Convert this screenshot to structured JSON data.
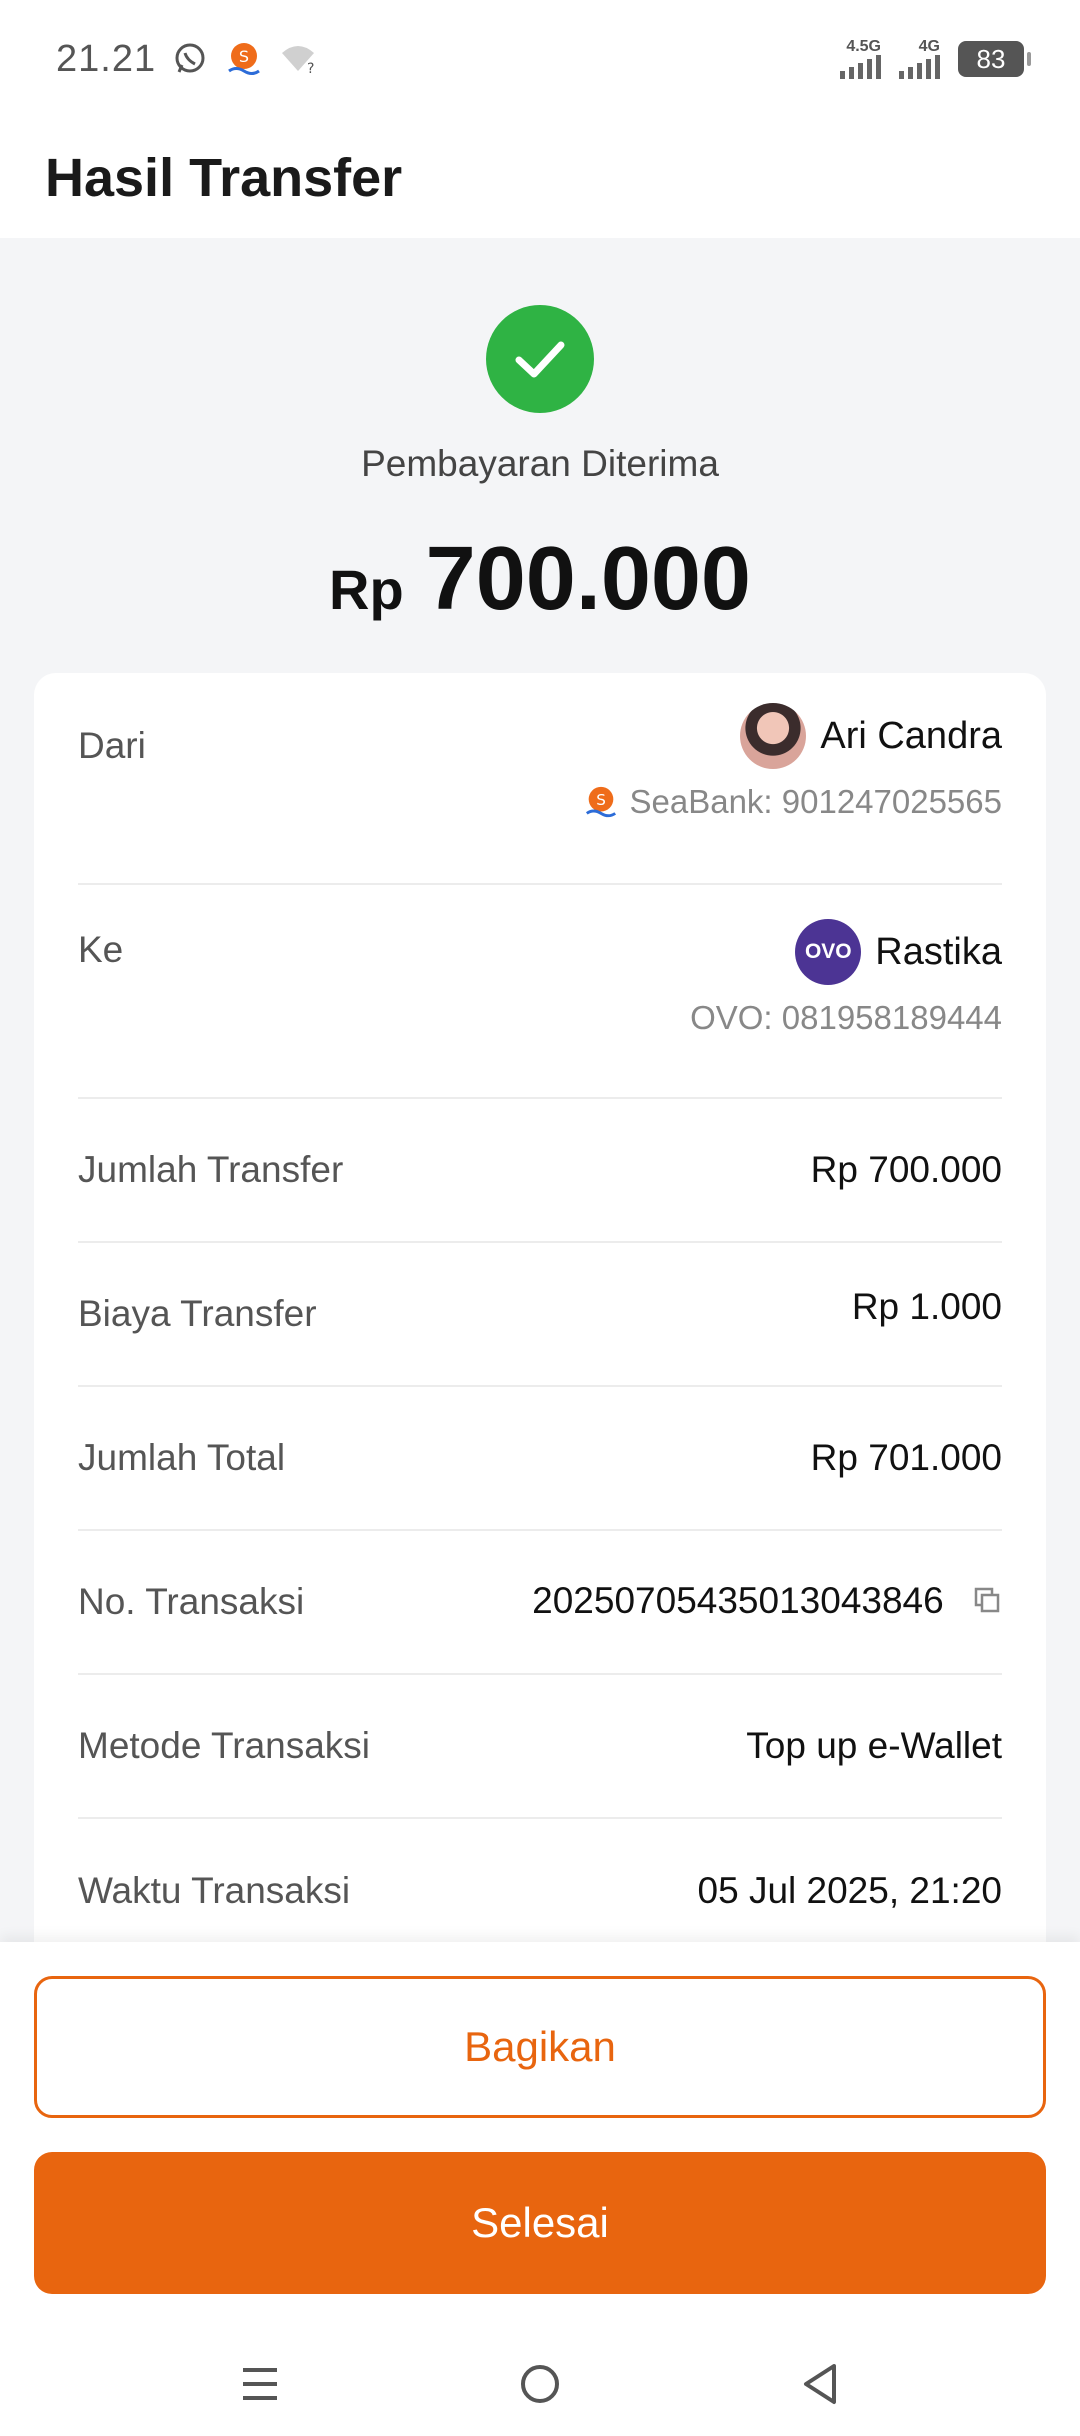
{
  "status_bar": {
    "time": "21.21",
    "network_1": "4.5G",
    "network_2": "4G",
    "battery": "83",
    "icons": [
      "whatsapp-icon",
      "seabank-icon",
      "wifi-unknown-icon"
    ]
  },
  "header": {
    "title": "Hasil Transfer"
  },
  "hero": {
    "status": "Pembayaran Diterima",
    "currency": "Rp",
    "amount": "700.000",
    "accent_color": "#2fb344"
  },
  "details": {
    "from": {
      "label": "Dari",
      "name": "Ari Candra",
      "account": "SeaBank: 901247025565"
    },
    "to": {
      "label": "Ke",
      "logo_text": "OVO",
      "name": "Rastika",
      "account": "OVO: 081958189444"
    },
    "rows": [
      {
        "label": "Jumlah Transfer",
        "value": "Rp 700.000"
      },
      {
        "label": "Biaya Transfer",
        "value": "Rp 1.000"
      },
      {
        "label": "Jumlah Total",
        "value": "Rp 701.000"
      },
      {
        "label": "No. Transaksi",
        "value": "20250705435013043846"
      },
      {
        "label": "Metode Transaksi",
        "value": "Top up e-Wallet"
      },
      {
        "label": "Waktu Transaksi",
        "value": "05 Jul 2025, 21:20"
      }
    ]
  },
  "actions": {
    "share_label": "Bagikan",
    "done_label": "Selesai",
    "brand_color": "#e8650f"
  },
  "nav": {
    "icons": [
      "menu-icon",
      "home-icon",
      "back-icon"
    ]
  }
}
